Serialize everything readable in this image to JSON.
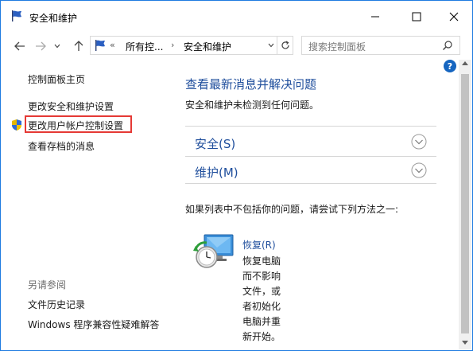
{
  "window": {
    "title": "安全和维护"
  },
  "nav": {
    "breadcrumb": {
      "chevrons": "«",
      "segment_1": "所有控...",
      "separator": "›",
      "segment_2": "安全和维护"
    },
    "search_placeholder": "搜索控制面板"
  },
  "sidebar": {
    "home": "控制面板主页",
    "change_security": "更改安全和维护设置",
    "change_uac": "更改用户帐户控制设置",
    "view_archived": "查看存档的消息",
    "see_also": "另请参阅",
    "file_history": "文件历史记录",
    "compat_troubleshooter": "Windows 程序兼容性疑难解答"
  },
  "main": {
    "title": "查看最新消息并解决问题",
    "subtitle": "安全和维护未检测到任何问题。",
    "sections": [
      {
        "label": "安全(S)"
      },
      {
        "label": "维护(M)"
      }
    ],
    "help_text": "如果列表中不包括你的问题，请尝试下列方法之一:",
    "restore": {
      "link": "恢复(R)",
      "description_lines": [
        "恢复电脑",
        "而不影响",
        "文件，或",
        "者初始化",
        "电脑并重",
        "新开始。"
      ]
    }
  },
  "colors": {
    "accent_link": "#1f4e9c",
    "highlight_box": "#e53935",
    "window_border": "#1e7be0"
  }
}
